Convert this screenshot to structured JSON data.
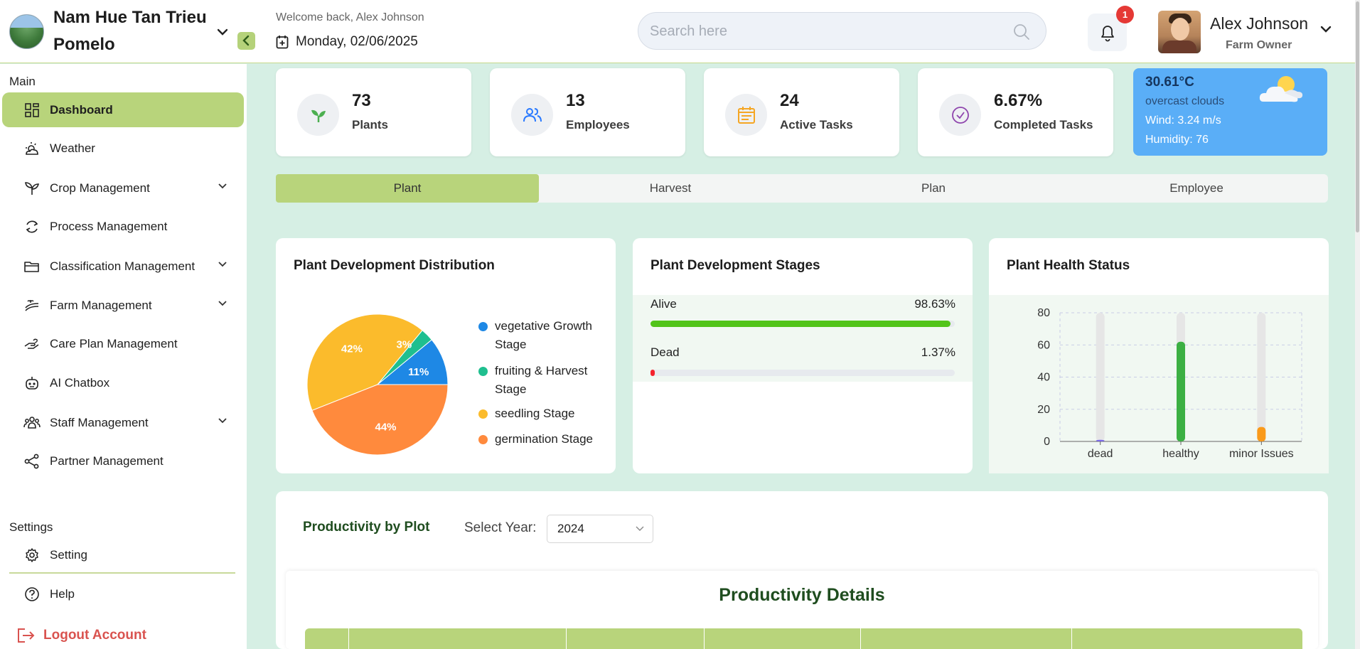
{
  "header": {
    "farm_name": "Nam Hue Tan Trieu Pomelo",
    "welcome": "Welcome back, Alex Johnson",
    "date": "Monday, 02/06/2025",
    "search_placeholder": "Search here",
    "notification_count": "1",
    "user_name": "Alex Johnson",
    "user_role": "Farm Owner"
  },
  "sidebar": {
    "main_title": "Main",
    "items": [
      {
        "label": "Dashboard",
        "icon": "dashboard-icon",
        "active": true,
        "has_chevron": false
      },
      {
        "label": "Weather",
        "icon": "weather-icon",
        "active": false,
        "has_chevron": false
      },
      {
        "label": "Crop Management",
        "icon": "sprout-icon",
        "active": false,
        "has_chevron": true
      },
      {
        "label": "Process Management",
        "icon": "cycle-icon",
        "active": false,
        "has_chevron": false
      },
      {
        "label": "Classification Management",
        "icon": "folder-icon",
        "active": false,
        "has_chevron": true
      },
      {
        "label": "Farm Management",
        "icon": "farm-icon",
        "active": false,
        "has_chevron": true
      },
      {
        "label": "Care Plan Management",
        "icon": "care-hand-icon",
        "active": false,
        "has_chevron": false
      },
      {
        "label": "AI Chatbox",
        "icon": "robot-icon",
        "active": false,
        "has_chevron": false
      },
      {
        "label": "Staff Management",
        "icon": "staff-icon",
        "active": false,
        "has_chevron": true
      },
      {
        "label": "Partner Management",
        "icon": "share-icon",
        "active": false,
        "has_chevron": false
      }
    ],
    "settings_title": "Settings",
    "settings_items": [
      {
        "label": "Setting",
        "icon": "gear-icon"
      },
      {
        "label": "Help",
        "icon": "help-icon"
      }
    ],
    "logout": "Logout Account"
  },
  "stats": [
    {
      "value": "73",
      "label": "Plants",
      "icon": "leaf-icon",
      "color": "#4caf50"
    },
    {
      "value": "13",
      "label": "Employees",
      "icon": "users-icon",
      "color": "#2979ff"
    },
    {
      "value": "24",
      "label": "Active Tasks",
      "icon": "calendar-icon",
      "color": "#f5a623"
    },
    {
      "value": "6.67%",
      "label": "Completed Tasks",
      "icon": "check-circle-icon",
      "color": "#8e44ad"
    }
  ],
  "weather": {
    "temp": "30.61°C",
    "desc": "overcast clouds",
    "wind": "Wind: 3.24 m/s",
    "humidity": "Humidity: 76",
    "icon": "partly-cloudy-icon"
  },
  "tabs": [
    "Plant",
    "Harvest",
    "Plan",
    "Employee"
  ],
  "active_tab": 0,
  "cards": {
    "distribution_title": "Plant Development Distribution",
    "stages_title": "Plant Development Stages",
    "health_title": "Plant Health Status"
  },
  "chart_data": [
    {
      "type": "pie",
      "title": "Plant Development Distribution",
      "slices": [
        {
          "label": "vegetative Growth Stage",
          "value": 11,
          "display": "11%",
          "color": "#1e88e5"
        },
        {
          "label": "fruiting & Harvest Stage",
          "value": 3,
          "display": "3%",
          "color": "#1fbf8f"
        },
        {
          "label": "seedling Stage",
          "value": 42,
          "display": "42%",
          "color": "#fbbb2c"
        },
        {
          "label": "germination Stage",
          "value": 44,
          "display": "44%",
          "color": "#ff8a3d"
        }
      ]
    },
    {
      "type": "bar",
      "title": "Plant Development Stages",
      "categories": [
        "Alive",
        "Dead"
      ],
      "values": [
        98.63,
        1.37
      ],
      "display": [
        "98.63%",
        "1.37%"
      ],
      "colors": [
        "#52c41a",
        "#f5222d"
      ],
      "ylim": [
        0,
        100
      ]
    },
    {
      "type": "bar",
      "title": "Plant Health Status",
      "categories": [
        "dead",
        "healthy",
        "minor Issues"
      ],
      "values": [
        1,
        62,
        9
      ],
      "colors": [
        "#7b68ee",
        "#3cb043",
        "#fa9a1a"
      ],
      "yticks": [
        0,
        20,
        40,
        60,
        80
      ],
      "ylim": [
        0,
        80
      ],
      "grid": true
    }
  ],
  "productivity": {
    "title": "Productivity by Plot",
    "year_label": "Select Year:",
    "year": "2024",
    "details_title": "Productivity Details"
  }
}
